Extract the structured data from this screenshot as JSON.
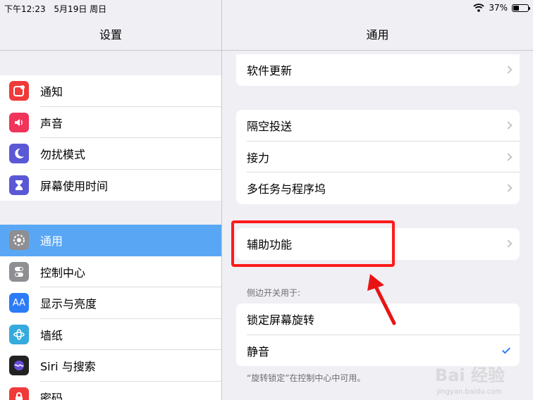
{
  "status": {
    "time": "下午12:23",
    "date": "5月19日 周日",
    "battery": "37%"
  },
  "left": {
    "title": "设置",
    "group1": [
      {
        "label": "通知",
        "icon": "notifications-icon",
        "color": "#f03a3a"
      },
      {
        "label": "声音",
        "icon": "sound-icon",
        "color": "#f0345a"
      },
      {
        "label": "勿扰模式",
        "icon": "moon-icon",
        "color": "#5b58d6"
      },
      {
        "label": "屏幕使用时间",
        "icon": "hourglass-icon",
        "color": "#5b58d6"
      }
    ],
    "group2": [
      {
        "label": "通用",
        "icon": "gear-icon",
        "color": "#8e8e93"
      },
      {
        "label": "控制中心",
        "icon": "toggles-icon",
        "color": "#8e8e93"
      },
      {
        "label": "显示与亮度",
        "icon": "display-icon",
        "color": "#2b7cf6"
      },
      {
        "label": "墙纸",
        "icon": "flower-icon",
        "color": "#35aadc"
      },
      {
        "label": "Siri 与搜索",
        "icon": "siri-icon",
        "color": "#222"
      },
      {
        "label": "密码",
        "icon": "lock-icon",
        "color": "#f03a3a"
      }
    ]
  },
  "right": {
    "title": "通用",
    "software_update": "软件更新",
    "airdrop": "隔空投送",
    "handoff": "接力",
    "multitasking": "多任务与程序坞",
    "accessibility": "辅助功能",
    "side_switch_header": "侧边开关用于:",
    "lock_rotation": "锁定屏幕旋转",
    "mute": "静音",
    "footnote": "“旋转锁定”在控制中心中可用。"
  },
  "watermark": {
    "brand": "Bai 经验",
    "url": "jingyan.baidu.com"
  },
  "colors": {
    "selected": "#59a7f4",
    "highlight": "#ff1a1a",
    "accent": "#2f7df6"
  }
}
